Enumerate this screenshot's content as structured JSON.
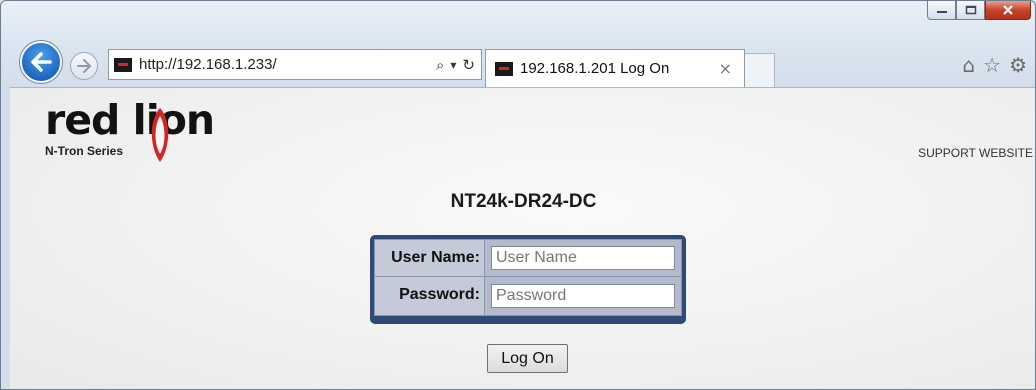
{
  "browser": {
    "address_url": "http://192.168.1.233/",
    "tab_title": "192.168.1.201 Log On",
    "tab_close": "×",
    "icons": [
      "back-arrow-icon",
      "forward-arrow-icon",
      "search-icon",
      "dropdown-icon",
      "refresh-icon",
      "home-icon",
      "favorites-star-icon",
      "settings-gear-icon",
      "minimize-icon",
      "maximize-icon",
      "close-icon"
    ],
    "search_glyph": "⌕",
    "dropdown_glyph": "▾",
    "refresh_glyph": "↻",
    "home_glyph": "⌂",
    "star_glyph": "☆",
    "gear_glyph": "⚙"
  },
  "page": {
    "brand_name": "red lion",
    "brand_series": "N-Tron Series",
    "support_link": "SUPPORT WEBSITE",
    "device_name": "NT24k-DR24-DC",
    "login": {
      "username_label": "User Name:",
      "username_placeholder": "User Name",
      "password_label": "Password:",
      "password_placeholder": "Password",
      "submit_label": "Log On"
    }
  },
  "colors": {
    "login_frame": "#2f4a74",
    "label_cell": "#c4cad7",
    "field_cell": "#b2bacb",
    "brand_red": "#d42323",
    "back_button": "#1f66c2"
  }
}
